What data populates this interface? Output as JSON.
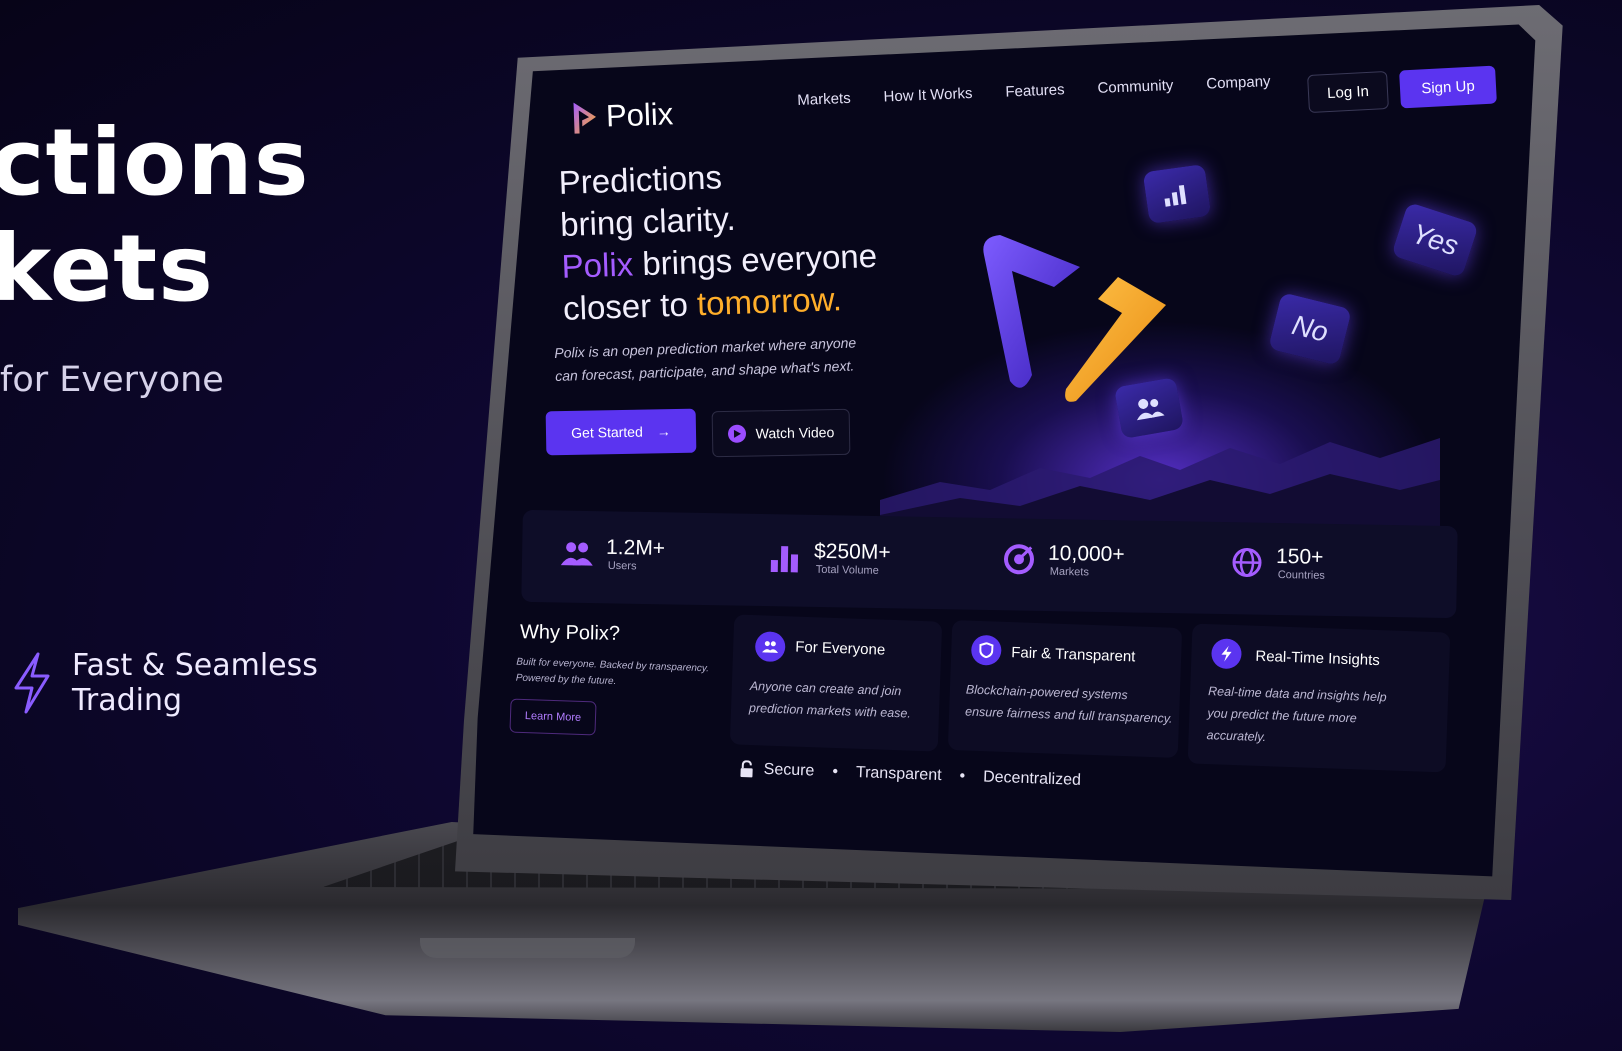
{
  "left_hero": {
    "headline_line1": "ctions",
    "headline_line2": "kets",
    "subtitle": "for Everyone",
    "feature_text_line1": "Fast & Seamless",
    "feature_text_line2": "Trading"
  },
  "screen": {
    "brand": "Polix",
    "nav": [
      "Markets",
      "How It Works",
      "Features",
      "Community",
      "Company"
    ],
    "login_label": "Log In",
    "signup_label": "Sign Up",
    "hero": {
      "line1": "Predictions",
      "line2": "bring clarity.",
      "line3_accent": "Polix",
      "line3_rest": " brings everyone",
      "line4_pre": "closer to ",
      "line4_accent": "tomorrow.",
      "description_line1": "Polix is an open prediction market where anyone",
      "description_line2": "can forecast, participate, and shape what's next."
    },
    "get_started_label": "Get Started",
    "watch_video_label": "Watch Video",
    "tiles": {
      "yes": "Yes",
      "no": "No"
    },
    "stats": [
      {
        "value": "1.2M+",
        "label": "Users",
        "icon": "users-icon"
      },
      {
        "value": "$250M+",
        "label": "Total Volume",
        "icon": "bar-chart-icon"
      },
      {
        "value": "10,000+",
        "label": "Markets",
        "icon": "target-icon"
      },
      {
        "value": "150+",
        "label": "Countries",
        "icon": "globe-icon"
      }
    ],
    "why": {
      "title": "Why Polix?",
      "desc_line1": "Built for everyone. Backed by transparency.",
      "desc_line2": "Powered by the future.",
      "learn_more": "Learn More"
    },
    "cards": [
      {
        "title": "For Everyone",
        "desc_line1": "Anyone can create and join",
        "desc_line2": "prediction markets with ease.",
        "desc_line3": ""
      },
      {
        "title": "Fair & Transparent",
        "desc_line1": "Blockchain-powered systems",
        "desc_line2": "ensure fairness and full transparency.",
        "desc_line3": ""
      },
      {
        "title": "Real-Time Insights",
        "desc_line1": "Real-time data and insights help",
        "desc_line2": "you predict the future more",
        "desc_line3": "accurately."
      }
    ],
    "trust": [
      "Secure",
      "Transparent",
      "Decentralized"
    ],
    "colors": {
      "accent_purple": "#5b34f0",
      "accent_orange": "#ffae2a",
      "text_purple": "#a45cff"
    }
  }
}
